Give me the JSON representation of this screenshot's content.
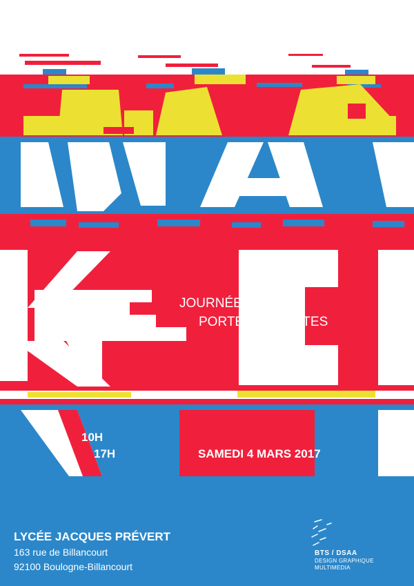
{
  "colors": {
    "red": "#f0203c",
    "blue": "#2b87c9",
    "yellow": "#ece132",
    "white": "#ffffff"
  },
  "event": {
    "line1": "JOURNÉE",
    "line2": "PORTES OUVERTES",
    "hour_start": "10H",
    "hour_end": "17H",
    "date": "SAMEDI 4 MARS 2017"
  },
  "venue": {
    "name": "LYCÉE JACQUES PRÉVERT",
    "street": "163 rue de Billancourt",
    "city": "92100 Boulogne-Billancourt"
  },
  "logo": {
    "title": "BTS / DSAA",
    "line1": "DESIGN GRAPHIQUE",
    "line2": "MULTIMEDIA"
  }
}
